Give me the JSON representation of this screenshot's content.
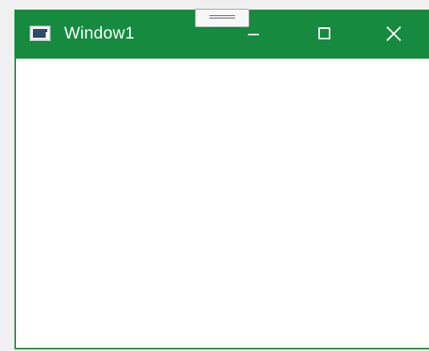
{
  "window": {
    "title": "Window1",
    "icon": "application-window-icon",
    "accent_color": "#168a3e",
    "buttons": {
      "minimize": "minimize-icon",
      "maximize": "maximize-icon",
      "close": "close-icon"
    }
  },
  "overlay": {
    "icon": "drag-handle-icon"
  }
}
